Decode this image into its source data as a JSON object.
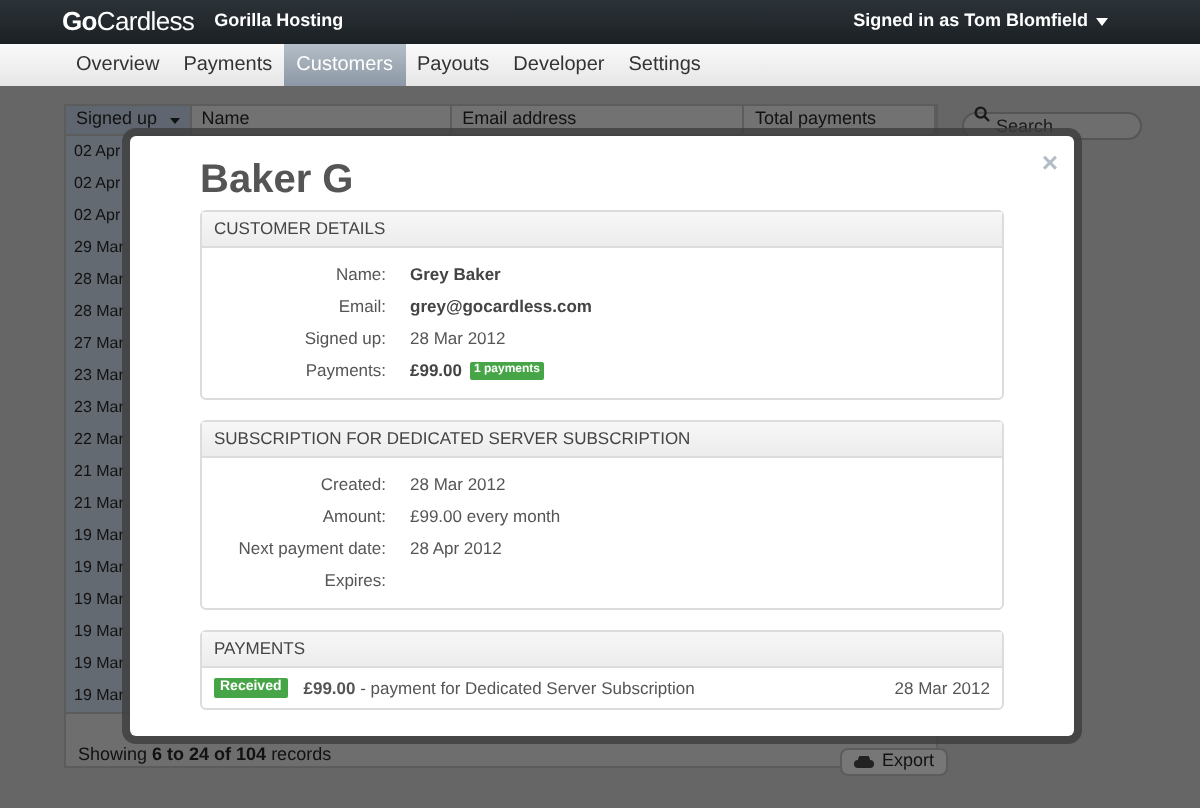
{
  "header": {
    "logo": "**Go**Cardless",
    "account": "Gorilla Hosting",
    "user_menu": "Signed in as Tom Blomfield"
  },
  "nav": [
    {
      "label": "Overview",
      "selected": false
    },
    {
      "label": "Payments",
      "selected": false
    },
    {
      "label": "Customers",
      "selected": true
    },
    {
      "label": "Payouts",
      "selected": false
    },
    {
      "label": "Developer",
      "selected": false
    },
    {
      "label": "Settings",
      "selected": false
    }
  ],
  "table": {
    "columns": [
      {
        "label": "Signed up",
        "sorted": true
      },
      {
        "label": "Name",
        "sorted": false
      },
      {
        "label": "Email address",
        "sorted": false
      },
      {
        "label": "Total payments",
        "sorted": false
      }
    ],
    "rows": [
      {
        "signed_up": "02 Apr"
      },
      {
        "signed_up": "02 Apr"
      },
      {
        "signed_up": "02 Apr"
      },
      {
        "signed_up": "29 Mar"
      },
      {
        "signed_up": "28 Mar"
      },
      {
        "signed_up": "28 Mar"
      },
      {
        "signed_up": "27 Mar"
      },
      {
        "signed_up": "23 Mar"
      },
      {
        "signed_up": "23 Mar"
      },
      {
        "signed_up": "22 Mar"
      },
      {
        "signed_up": "21 Mar"
      },
      {
        "signed_up": "21 Mar"
      },
      {
        "signed_up": "19 Mar"
      },
      {
        "signed_up": "19 Mar"
      },
      {
        "signed_up": "19 Mar"
      },
      {
        "signed_up": "19 Mar"
      },
      {
        "signed_up": "19 Mar"
      },
      {
        "signed_up": "19 Mar"
      }
    ],
    "footer": "Showing **6 to 24 of 104** records",
    "export": "Export"
  },
  "search": {
    "placeholder": "Search"
  },
  "modal": {
    "title": "Baker G",
    "close": "×",
    "sections": [
      {
        "kind": "details",
        "title": "CUSTOMER DETAILS",
        "fields": [
          {
            "label": "Name:",
            "value": "Grey Baker",
            "bold": true
          },
          {
            "label": "Email:",
            "value": "grey@gocardless.com",
            "bold": true
          },
          {
            "label": "Signed up:",
            "value": "28 Mar 2012",
            "bold": false
          },
          {
            "label": "Payments:",
            "value": "£99.00",
            "bold": true,
            "badge": "1 payments"
          }
        ]
      },
      {
        "kind": "details",
        "title": "SUBSCRIPTION FOR DEDICATED SERVER SUBSCRIPTION",
        "fields": [
          {
            "label": "Created:",
            "value": "28 Mar 2012",
            "bold": false
          },
          {
            "label": "Amount:",
            "value": "£99.00 every month",
            "bold": false
          },
          {
            "label": "Next payment date:",
            "value": "28 Apr 2012",
            "bold": false
          },
          {
            "label": "Expires:"
          }
        ]
      },
      {
        "kind": "payments",
        "title": "PAYMENTS",
        "items": [
          {
            "status": "Received",
            "description": "**£99.00** - payment for Dedicated Server Subscription",
            "date": "28 Mar 2012"
          }
        ]
      }
    ]
  }
}
